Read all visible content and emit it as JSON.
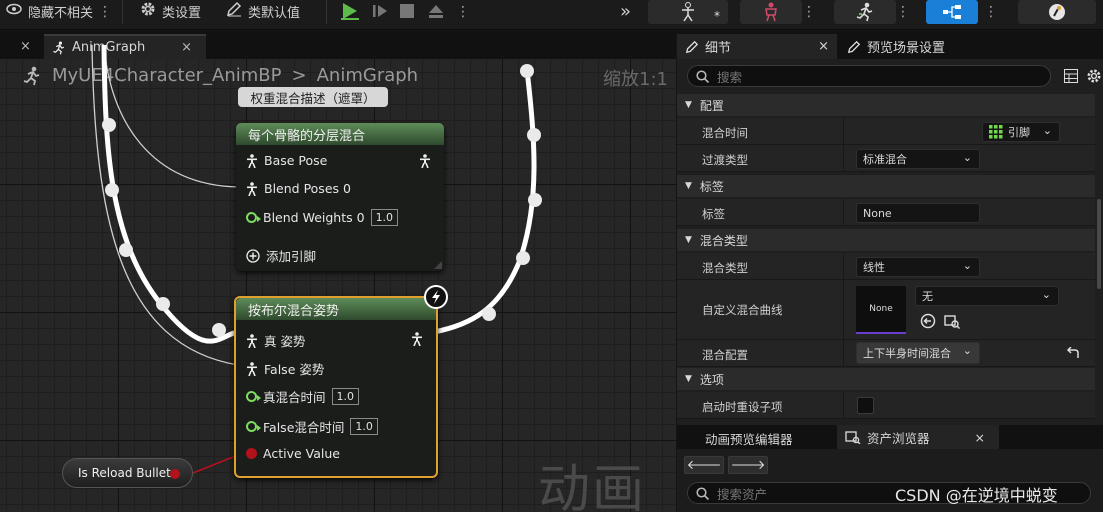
{
  "toolbar": {
    "hide_unrelated": "隐藏不相关",
    "class_settings": "类设置",
    "class_defaults": "类默认值"
  },
  "graph_tabs": {
    "first_tab_close": "×",
    "active_tab": "AnimGraph",
    "active_tab_close": "×"
  },
  "graph": {
    "breadcrumb_root": "MyUE4Character_AnimBP",
    "breadcrumb_sep": ">",
    "breadcrumb_current": "AnimGraph",
    "zoom_label": "缩放1:1",
    "watermark": "动画",
    "comment_bubble": "权重混合描述（遮罩）",
    "layered_node": {
      "title": "每个骨骼的分层混合",
      "pins": [
        "Base Pose",
        "Blend Poses 0",
        "Blend Weights 0"
      ],
      "blend_weight_value": "1.0",
      "add_pin": "添加引脚"
    },
    "bool_node": {
      "title": "按布尔混合姿势",
      "pins": [
        "真 姿势",
        "False 姿势",
        "真混合时间",
        "False混合时间",
        "Active Value"
      ],
      "true_blend_value": "1.0",
      "false_blend_value": "1.0"
    },
    "variable_node": "Is Reload Bullet"
  },
  "details": {
    "tab_details": "细节",
    "tab_details_close": "×",
    "tab_preview": "预览场景设置",
    "search_placeholder": "搜索",
    "sections": {
      "config": "配置",
      "tag": "标签",
      "blend_type": "混合类型",
      "options": "选项"
    },
    "rows": {
      "blend_time": {
        "label": "混合时间",
        "value": "引脚"
      },
      "transition_type": {
        "label": "过渡类型",
        "value": "标准混合"
      },
      "tag": {
        "label": "标签",
        "value": "None"
      },
      "blend_type": {
        "label": "混合类型",
        "value": "线性"
      },
      "custom_curve": {
        "label": "自定义混合曲线",
        "thumb": "None",
        "value": "无"
      },
      "blend_profile": {
        "label": "混合配置",
        "value": "上下半身时间混合"
      },
      "reset_child": {
        "label": "启动时重设子项"
      }
    }
  },
  "assets": {
    "tab_anim_editor": "动画预览编辑器",
    "tab_asset_browser": "资产浏览器",
    "tab_close": "×",
    "search_placeholder": "搜索资产"
  },
  "watermark_csdn": "CSDN @在逆境中蜕变",
  "colors": {
    "node_header": "#4f7a4a",
    "exec_wire": "#ffffff",
    "float_pin": "#7fdc5e",
    "bool_pin": "#b3121c",
    "selected_outline": "#e0a030",
    "accent_blue": "#1a7fd6"
  }
}
